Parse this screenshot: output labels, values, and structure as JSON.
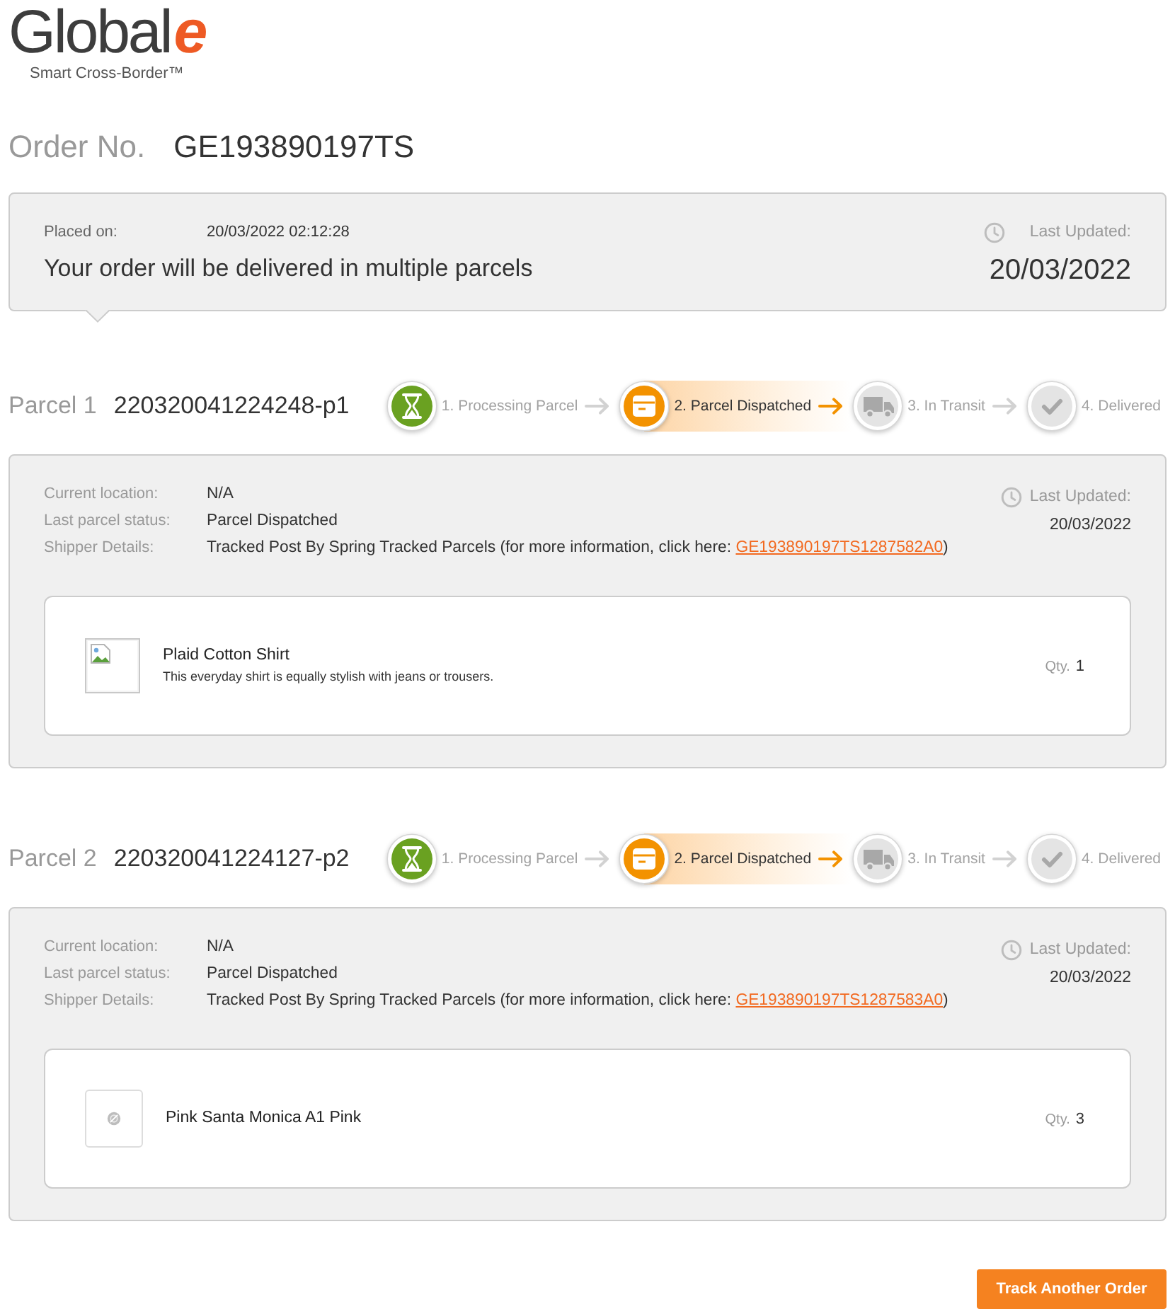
{
  "logo": {
    "name": "Global",
    "accent": "e",
    "tagline": "Smart Cross-Border™"
  },
  "order": {
    "label": "Order No.",
    "number": "GE193890197TS"
  },
  "summary": {
    "placed_label": "Placed on:",
    "placed_value": "20/03/2022 02:12:28",
    "message": "Your order will be delivered in multiple parcels",
    "updated_label": "Last Updated:",
    "updated_value": "20/03/2022"
  },
  "parcels": [
    {
      "label": "Parcel 1",
      "number": "220320041224248-p1",
      "steps": [
        {
          "label": "1. Processing Parcel",
          "kind": "processing",
          "done": true,
          "current": false
        },
        {
          "label": "2. Parcel Dispatched",
          "kind": "dispatched",
          "done": true,
          "current": true
        },
        {
          "label": "3. In Transit",
          "kind": "transit",
          "done": false,
          "current": false
        },
        {
          "label": "4. Delivered",
          "kind": "delivered",
          "done": false,
          "current": false
        }
      ],
      "details": [
        {
          "label": "Current location:",
          "value": "N/A"
        },
        {
          "label": "Last parcel status:",
          "value": "Parcel Dispatched"
        },
        {
          "label": "Shipper Details:",
          "value": "Tracked Post By Spring Tracked Parcels (for more information, click here: ",
          "link": "GE193890197TS1287582A0",
          "after": ")"
        }
      ],
      "updated_label": "Last Updated:",
      "updated_value": "20/03/2022",
      "items": [
        {
          "kind": "broken-image",
          "name": "Plaid Cotton Shirt",
          "description": "This everyday shirt is equally stylish with jeans or trousers.",
          "qty_label": "Qty.",
          "qty": "1"
        }
      ]
    },
    {
      "label": "Parcel 2",
      "number": "220320041224127-p2",
      "steps": [
        {
          "label": "1. Processing Parcel",
          "kind": "processing",
          "done": true,
          "current": false
        },
        {
          "label": "2. Parcel Dispatched",
          "kind": "dispatched",
          "done": true,
          "current": true
        },
        {
          "label": "3. In Transit",
          "kind": "transit",
          "done": false,
          "current": false
        },
        {
          "label": "4. Delivered",
          "kind": "delivered",
          "done": false,
          "current": false
        }
      ],
      "details": [
        {
          "label": "Current location:",
          "value": "N/A"
        },
        {
          "label": "Last parcel status:",
          "value": "Parcel Dispatched"
        },
        {
          "label": "Shipper Details:",
          "value": "Tracked Post By Spring Tracked Parcels (for more information, click here: ",
          "link": "GE193890197TS1287583A0",
          "after": ")"
        }
      ],
      "updated_label": "Last Updated:",
      "updated_value": "20/03/2022",
      "items": [
        {
          "kind": "no-image",
          "name": "Pink Santa Monica A1 Pink",
          "qty_label": "Qty.",
          "qty": "3"
        }
      ]
    }
  ],
  "button": "Track Another Order"
}
